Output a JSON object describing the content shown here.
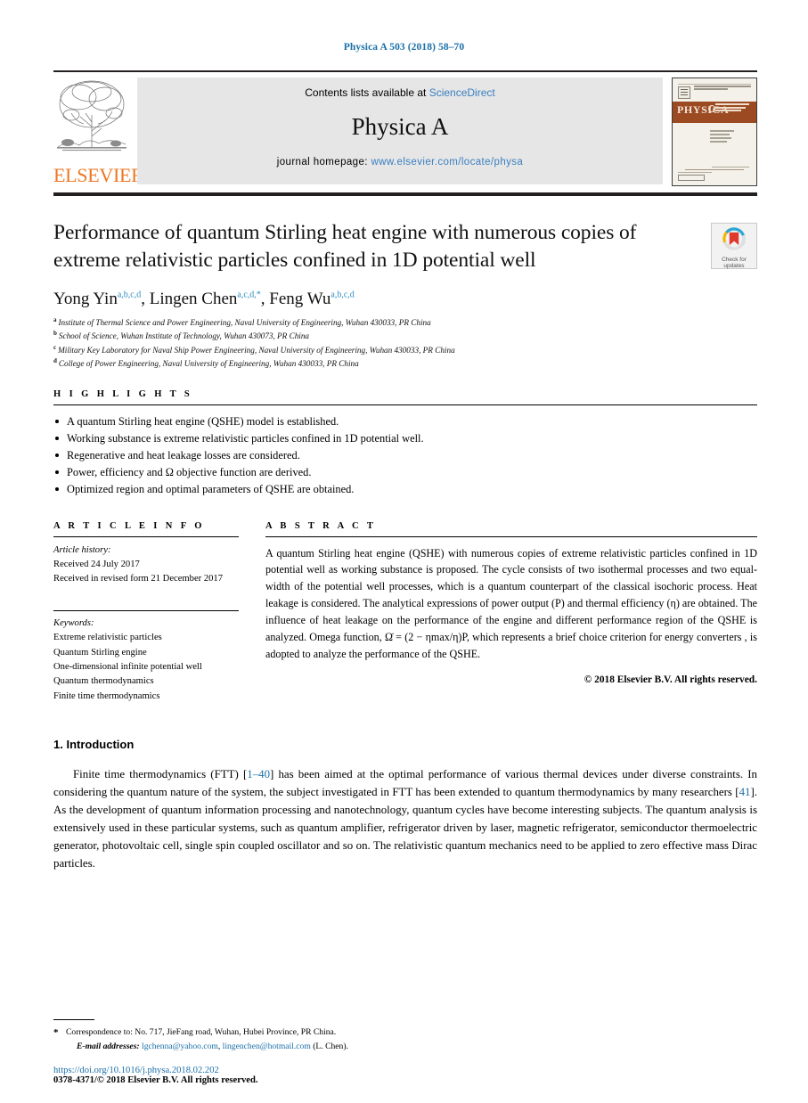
{
  "running_head": "Physica A 503 (2018) 58–70",
  "masthead": {
    "publisher_name": "ELSEVIER",
    "contents_prefix": "Contents lists available at",
    "contents_link": "ScienceDirect",
    "journal_title": "Physica A",
    "homepage_prefix": "journal homepage:",
    "homepage_link": "www.elsevier.com/locate/physa",
    "cover_title": "PHYSICA",
    "cover_subtitle": "STATISTICAL MECHANICS AND ITS APPLICATIONS",
    "link_color": "#3a7fc1",
    "elsevier_orange": "#ee7623"
  },
  "crossmark": {
    "label_line1": "Check for",
    "label_line2": "updates"
  },
  "article": {
    "title": "Performance of quantum Stirling heat engine with numerous copies of extreme relativistic particles confined in 1D potential well",
    "authors": [
      {
        "name": "Yong Yin",
        "sup": "a,b,c,d"
      },
      {
        "name": "Lingen Chen",
        "sup": "a,c,d,*"
      },
      {
        "name": "Feng Wu",
        "sup": "a,b,c,d"
      }
    ],
    "affiliations": [
      {
        "mark": "a",
        "text": "Institute of Thermal Science and Power Engineering, Naval University of Engineering, Wuhan 430033, PR China"
      },
      {
        "mark": "b",
        "text": "School of Science, Wuhan Institute of Technology, Wuhan 430073, PR China"
      },
      {
        "mark": "c",
        "text": "Military Key Laboratory for Naval Ship Power Engineering, Naval University of Engineering, Wuhan 430033, PR China"
      },
      {
        "mark": "d",
        "text": "College of Power Engineering, Naval University of Engineering, Wuhan 430033, PR China"
      }
    ]
  },
  "highlights": {
    "heading": "H I G H L I G H T S",
    "items": [
      "A quantum Stirling heat engine (QSHE) model is established.",
      "Working substance is extreme relativistic particles confined in 1D potential well.",
      "Regenerative and heat leakage losses are considered.",
      "Power, efficiency and Ω objective function are derived.",
      "Optimized region and optimal parameters of QSHE are obtained."
    ]
  },
  "article_info": {
    "heading": "A R T I C L E     I N F O",
    "history_label": "Article history:",
    "history": [
      "Received 24 July 2017",
      "Received in revised form 21 December 2017"
    ],
    "keywords_label": "Keywords:",
    "keywords": [
      "Extreme relativistic particles",
      "Quantum Stirling engine",
      "One-dimensional infinite potential well",
      "Quantum thermodynamics",
      "Finite time thermodynamics"
    ]
  },
  "abstract": {
    "heading": "A B S T R A C T",
    "text": "A quantum Stirling heat engine (QSHE) with numerous copies of extreme relativistic particles confined in 1D potential well as working substance is proposed. The cycle consists of two isothermal processes and two equal-width of the potential well processes, which is a quantum counterpart of the classical isochoric process. Heat leakage is considered. The analytical expressions of power output (P) and thermal efficiency (η) are obtained. The influence of heat leakage on the performance of the engine and different performance region of the QSHE is analyzed. Omega function, Ω̇ = (2 − ηmax/η)P, which represents a brief choice criterion for energy converters , is adopted to analyze the performance of the QSHE.",
    "copyright": "© 2018 Elsevier B.V. All rights reserved."
  },
  "introduction": {
    "heading": "1. Introduction",
    "paragraph_part1": "Finite time thermodynamics (FTT) [",
    "ref1": "1–40",
    "paragraph_part2": "] has been aimed at the optimal performance of various thermal devices under diverse constraints. In considering the quantum nature of the system, the subject investigated in FTT has been extended to quantum thermodynamics by many researchers [",
    "ref2": "41",
    "paragraph_part3": "]. As the development of quantum information processing and nanotechnology, quantum cycles have become interesting subjects. The quantum analysis is extensively used in these particular systems, such as quantum amplifier, refrigerator driven by laser, magnetic refrigerator, semiconductor thermoelectric generator, photovoltaic cell, single spin coupled oscillator and so on. The relativistic quantum mechanics need to be applied to zero effective mass Dirac particles."
  },
  "footnotes": {
    "correspondence": "Correspondence to: No. 717, JieFang road, Wuhan, Hubei Province, PR China.",
    "email_label": "E-mail addresses:",
    "email1": "lgchenna@yahoo.com",
    "email2": "lingenchen@hotmail.com",
    "email_suffix": "(L. Chen).",
    "doi": "https://doi.org/10.1016/j.physa.2018.02.202",
    "issn_line": "0378-4371/© 2018 Elsevier B.V. All rights reserved."
  }
}
